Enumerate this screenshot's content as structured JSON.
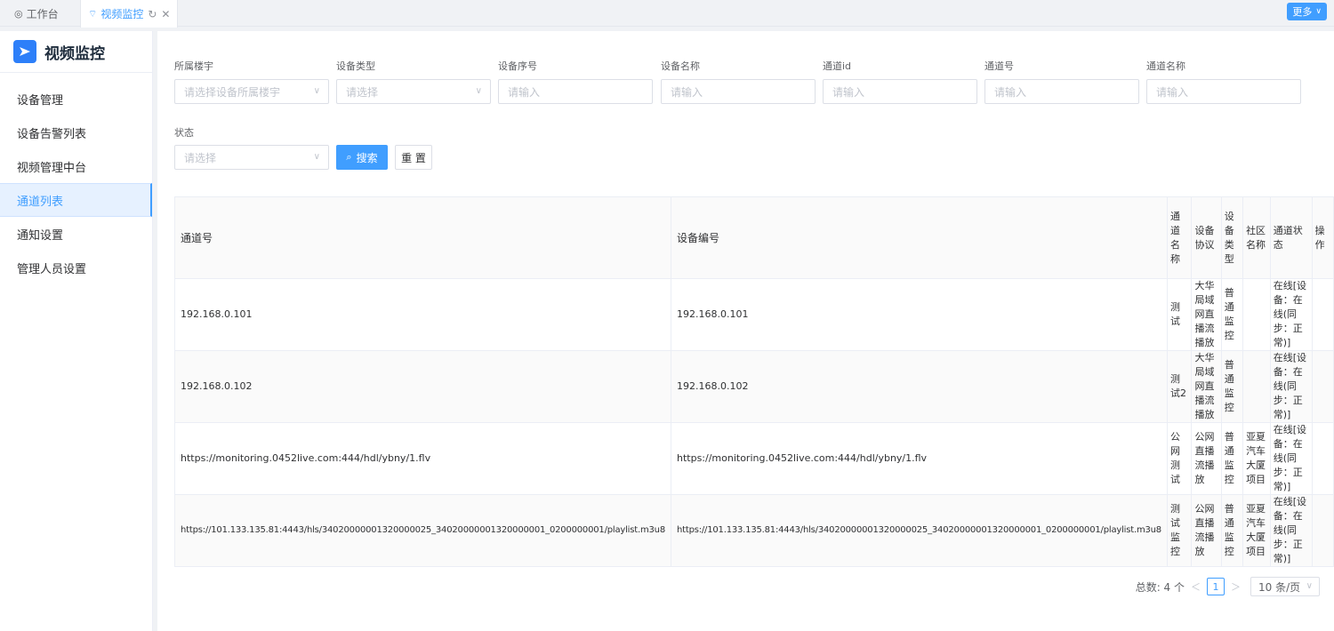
{
  "tabs": [
    {
      "label": "工作台",
      "icon": "dashboard-icon"
    },
    {
      "label": "视频监控",
      "icon": "video-icon",
      "active": true
    }
  ],
  "more_label": "更多",
  "sidebar": {
    "title": "视频监控",
    "items": [
      {
        "label": "设备管理"
      },
      {
        "label": "设备告警列表"
      },
      {
        "label": "视频管理中台"
      },
      {
        "label": "通道列表",
        "active": true
      },
      {
        "label": "通知设置"
      },
      {
        "label": "管理人员设置"
      }
    ]
  },
  "filters": [
    {
      "label": "所属楼宇",
      "placeholder": "请选择设备所属楼宇",
      "type": "select"
    },
    {
      "label": "设备类型",
      "placeholder": "请选择",
      "type": "select"
    },
    {
      "label": "设备序号",
      "placeholder": "请输入",
      "type": "input"
    },
    {
      "label": "设备名称",
      "placeholder": "请输入",
      "type": "input"
    },
    {
      "label": "通道id",
      "placeholder": "请输入",
      "type": "input"
    },
    {
      "label": "通道号",
      "placeholder": "请输入",
      "type": "input"
    },
    {
      "label": "通道名称",
      "placeholder": "请输入",
      "type": "input"
    },
    {
      "label": "状态",
      "placeholder": "请选择",
      "type": "select"
    }
  ],
  "buttons": {
    "search": "搜索",
    "reset": "重 置"
  },
  "table": {
    "headers": [
      "通道号",
      "设备编号",
      "通道名称",
      "设备协议",
      "设备类型",
      "社区名称",
      "通道状态",
      "操作"
    ],
    "rows": [
      [
        "192.168.0.101",
        "192.168.0.101",
        "测试",
        "大华局域网直播流播放",
        "普通监控",
        "",
        "在线[设备：在线(同步：正常)]",
        ""
      ],
      [
        "192.168.0.102",
        "192.168.0.102",
        "测试2",
        "大华局域网直播流播放",
        "普通监控",
        "",
        "在线[设备：在线(同步：正常)]",
        ""
      ],
      [
        "https://monitoring.0452live.com:444/hdl/ybny/1.flv",
        "https://monitoring.0452live.com:444/hdl/ybny/1.flv",
        "公网测试",
        "公网直播流播放",
        "普通监控",
        "亚夏汽车大厦项目",
        "在线[设备：在线(同步：正常)]",
        ""
      ],
      [
        "https://101.133.135.81:4443/hls/34020000001320000025_34020000001320000001_0200000001/playlist.m3u8",
        "https://101.133.135.81:4443/hls/34020000001320000025_34020000001320000001_0200000001/playlist.m3u8",
        "测试监控",
        "公网直播流播放",
        "普通监控",
        "亚夏汽车大厦项目",
        "在线[设备：在线(同步：正常)]",
        ""
      ]
    ]
  },
  "pagination": {
    "total_label": "总数: 4 个",
    "current_page": "1",
    "page_size": "10 条/页"
  }
}
